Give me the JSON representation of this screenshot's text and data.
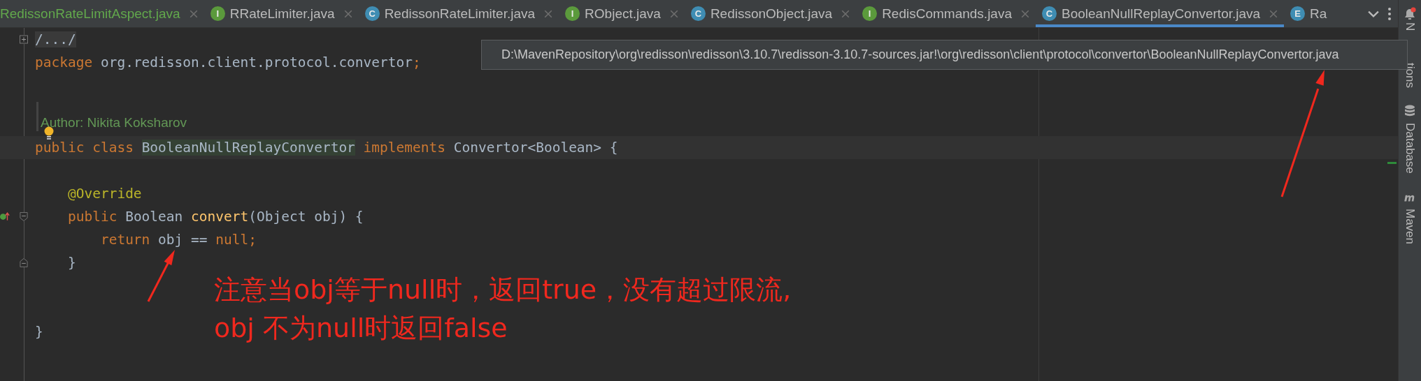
{
  "tabs": [
    {
      "label": "RedissonRateLimitAspect.java",
      "color": "#62a84c",
      "selected": false
    },
    {
      "label": "RRateLimiter.java",
      "icon": {
        "letter": "I",
        "color": "#5b9a3c"
      },
      "color": "#bbbbbb",
      "selected": false
    },
    {
      "label": "RedissonRateLimiter.java",
      "icon": {
        "letter": "C",
        "color": "#3f8db3"
      },
      "color": "#bbbbbb",
      "selected": false
    },
    {
      "label": "RObject.java",
      "icon": {
        "letter": "I",
        "color": "#5b9a3c"
      },
      "color": "#bbbbbb",
      "selected": false
    },
    {
      "label": "RedissonObject.java",
      "icon": {
        "letter": "C",
        "color": "#3f8db3"
      },
      "color": "#bbbbbb",
      "selected": false
    },
    {
      "label": "RedisCommands.java",
      "icon": {
        "letter": "I",
        "color": "#5b9a3c"
      },
      "color": "#bbbbbb",
      "selected": false
    },
    {
      "label": "BooleanNullReplayConvertor.java",
      "icon": {
        "letter": "C",
        "color": "#3f8db3"
      },
      "color": "#bbbbbb",
      "selected": true
    },
    {
      "label": "Ra",
      "icon": {
        "letter": "E",
        "color": "#3f8db3"
      },
      "color": "#bbbbbb",
      "selected": false
    }
  ],
  "tooltip": {
    "text": "D:\\MavenRepository\\org\\redisson\\redisson\\3.10.7\\redisson-3.10.7-sources.jar!\\org\\redisson\\client\\protocol\\convertor\\BooleanNullReplayConvertor.java"
  },
  "editor": {
    "lines": [
      {
        "kind": "code",
        "marks": [
          {
            "kind": "fold"
          }
        ],
        "current": false,
        "tokens": [
          {
            "text": "/.../",
            "kind": "folded"
          }
        ]
      },
      {
        "kind": "code",
        "current": false,
        "tokens": [
          {
            "text": "package ",
            "kind": "keyword"
          },
          {
            "text": "org.redisson.client.protocol.convertor",
            "kind": "plain"
          },
          {
            "text": ";",
            "kind": "keyword"
          }
        ]
      },
      {
        "kind": "doc",
        "text": "Author: Nikita Koksharov"
      },
      {
        "kind": "code",
        "marks": [
          {
            "kind": "bulb"
          }
        ],
        "current": true,
        "tokens": [
          {
            "text": "public class ",
            "kind": "keyword"
          },
          {
            "text": "BooleanNullReplayConvertor",
            "kind": "highlight"
          },
          {
            "text": " implements ",
            "kind": "keyword"
          },
          {
            "text": "Convertor<Boolean> {",
            "kind": "plain"
          }
        ]
      },
      {
        "kind": "blank"
      },
      {
        "kind": "code",
        "current": false,
        "tokens": [
          {
            "text": "    @Override",
            "kind": "annotation"
          }
        ]
      },
      {
        "kind": "code",
        "marks": [
          {
            "kind": "override"
          },
          {
            "kind": "fold-start"
          }
        ],
        "current": false,
        "tokens": [
          {
            "text": "    public ",
            "kind": "keyword"
          },
          {
            "text": "Boolean ",
            "kind": "plain"
          },
          {
            "text": "convert",
            "kind": "method"
          },
          {
            "text": "(Object obj) {",
            "kind": "plain"
          }
        ]
      },
      {
        "kind": "code",
        "current": false,
        "tokens": [
          {
            "text": "        return ",
            "kind": "keyword"
          },
          {
            "text": "obj == ",
            "kind": "plain"
          },
          {
            "text": "null;",
            "kind": "keyword"
          }
        ]
      },
      {
        "kind": "code",
        "marks": [
          {
            "kind": "fold-end"
          }
        ],
        "current": false,
        "tokens": [
          {
            "text": "    }",
            "kind": "plain"
          }
        ]
      },
      {
        "kind": "blank"
      },
      {
        "kind": "blank"
      },
      {
        "kind": "code",
        "current": false,
        "tokens": [
          {
            "text": "}",
            "kind": "plain"
          }
        ]
      }
    ]
  },
  "sidebar": {
    "items": [
      {
        "kind": "notifications",
        "parts": [
          "N",
          "tions"
        ]
      },
      {
        "kind": "database",
        "parts": [
          "Database"
        ]
      },
      {
        "kind": "maven",
        "parts": [
          "Maven"
        ]
      }
    ]
  },
  "annotations": [
    {
      "kind": "arrow"
    },
    {
      "kind": "note",
      "lines": [
        "注意当obj等于null时，返回true，没有超过限流,",
        "obj 不为null时返回false"
      ]
    },
    {
      "kind": "arrow"
    }
  ]
}
